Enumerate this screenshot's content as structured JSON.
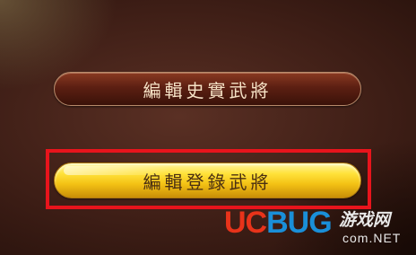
{
  "menu": {
    "items": [
      {
        "label": "編輯史實武將",
        "state": "normal"
      },
      {
        "label": "編輯登錄武將",
        "state": "highlighted"
      }
    ]
  },
  "annotation": {
    "highlight_color": "#e8141c"
  },
  "watermark": {
    "brand_uc": "UC",
    "brand_bug": "BUG",
    "site_name": "游戏网",
    "domain": "com.NET"
  }
}
